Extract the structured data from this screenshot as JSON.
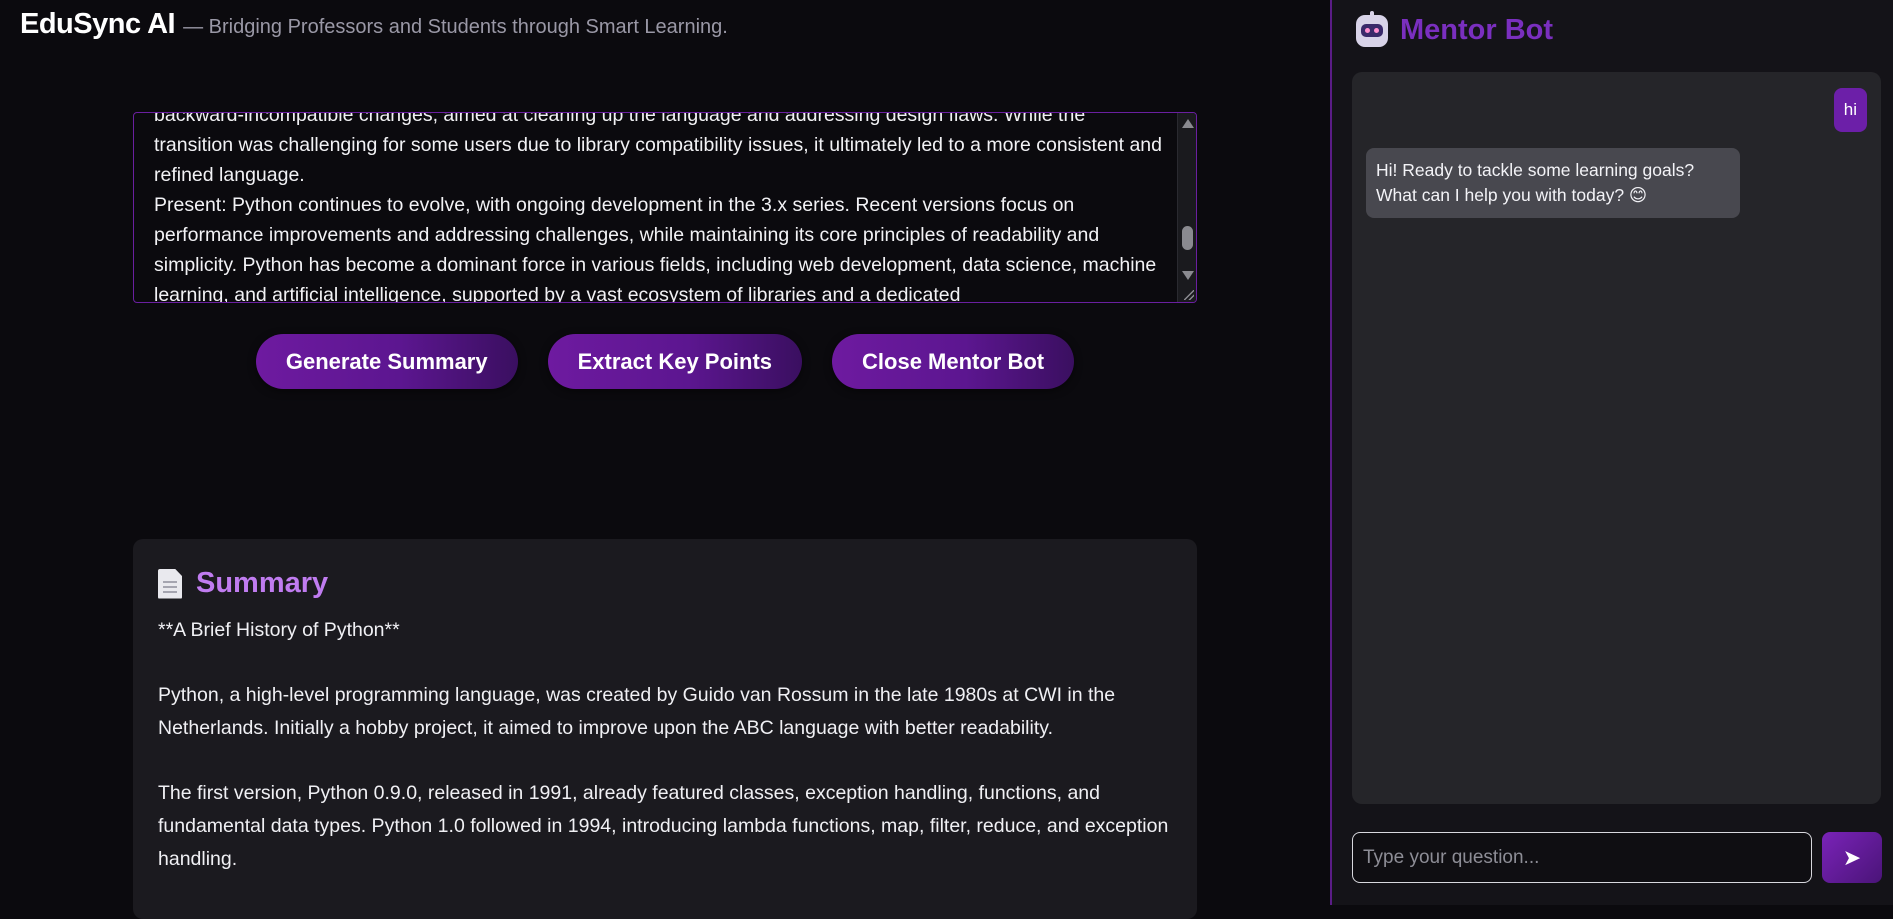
{
  "header": {
    "title": "EduSync AI",
    "tagline": "— Bridging Professors and Students through Smart Learning."
  },
  "notes": {
    "lines": [
      "backward-incompatible changes, aimed at cleaning up the language and addressing design flaws. While the transition was challenging for some users due to library compatibility issues, it ultimately led to a more consistent and refined language.",
      "Present: Python continues to evolve, with ongoing development in the 3.x series. Recent versions focus on performance improvements and addressing challenges, while maintaining its core principles of readability and simplicity. Python has become a dominant force in various fields, including web development, data science, machine learning, and artificial intelligence, supported by a vast ecosystem of libraries and a dedicated"
    ]
  },
  "actions": {
    "summary_label": "Generate Summary",
    "keypoints_label": "Extract Key Points",
    "close_label": "Close Mentor Bot"
  },
  "summary": {
    "title": "Summary",
    "paragraphs": [
      "**A Brief History of Python**",
      "Python, a high-level programming language, was created by Guido van Rossum in the late 1980s at CWI in the Netherlands. Initially a hobby project, it aimed to improve upon the ABC language with better readability.",
      "The first version, Python 0.9.0, released in 1991, already featured classes, exception handling, functions, and fundamental data types. Python 1.0 followed in 1994, introducing lambda functions, map, filter, reduce, and exception handling."
    ]
  },
  "chat": {
    "title": "Mentor Bot",
    "messages": {
      "user": "hi",
      "bot_line1": "Hi! Ready to tackle some learning goals?",
      "bot_line2": "What can I help you with today? 😊"
    },
    "input_placeholder": "Type your question...",
    "send_icon": "➤"
  },
  "colors": {
    "accent": "#6e1aa0",
    "summary_title": "#c07cf0",
    "chat_title": "#7a2fbf",
    "background": "#0b0a0e"
  }
}
